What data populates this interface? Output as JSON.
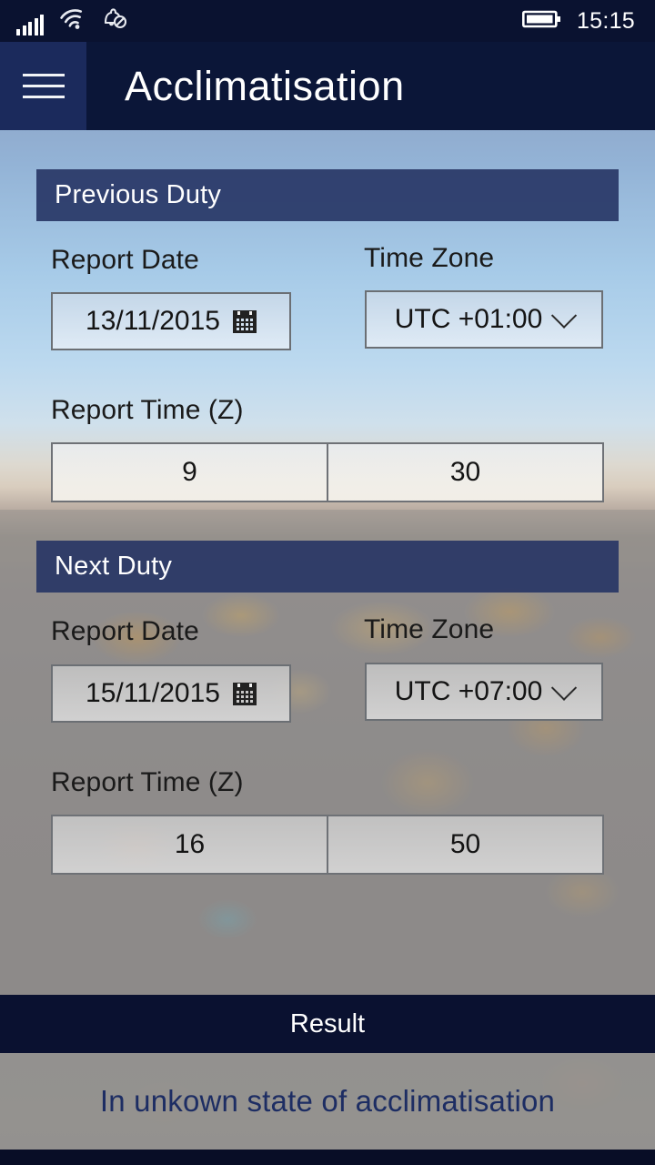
{
  "statusbar": {
    "signal_icon": "cellular-signal-icon",
    "wifi_icon": "wifi-icon",
    "notification_icon": "bell-muted-icon",
    "battery_icon": "battery-full-icon",
    "time": "15:15"
  },
  "titlebar": {
    "menu_icon": "hamburger-menu-icon",
    "title": "Acclimatisation"
  },
  "sections": [
    {
      "header": "Previous Duty",
      "report_date_label": "Report Date",
      "report_date_value": "13/11/2015",
      "calendar_icon": "calendar-icon",
      "time_zone_label": "Time Zone",
      "time_zone_value": "UTC +01:00",
      "chevron_icon": "chevron-down-icon",
      "report_time_label": "Report Time (Z)",
      "hours": "9",
      "minutes": "30"
    },
    {
      "header": "Next Duty",
      "report_date_label": "Report Date",
      "report_date_value": "15/11/2015",
      "calendar_icon": "calendar-icon",
      "time_zone_label": "Time Zone",
      "time_zone_value": "UTC +07:00",
      "chevron_icon": "chevron-down-icon",
      "report_time_label": "Report Time (Z)",
      "hours": "16",
      "minutes": "50"
    }
  ],
  "result": {
    "header": "Result",
    "text": "In unkown state of acclimatisation"
  },
  "colors": {
    "titlebar": "#0b1638",
    "hamburger": "#1b2a5c",
    "section_header": "#263464",
    "result_bar": "#0a1130",
    "result_text": "#1d2d63",
    "statusbar": "#0a1230"
  }
}
